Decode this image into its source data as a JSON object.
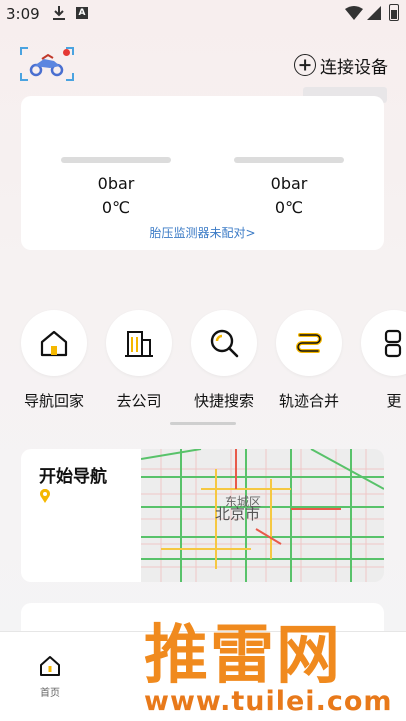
{
  "status_bar": {
    "time": "3:09",
    "a_badge": "A"
  },
  "header": {
    "connect_label": "连接设备"
  },
  "tire_card": {
    "left": {
      "pressure": "0bar",
      "temperature": "0℃"
    },
    "right": {
      "pressure": "0bar",
      "temperature": "0℃"
    },
    "link_text": "胎压监测器未配对>"
  },
  "quick_actions": [
    {
      "label": "导航回家",
      "icon": "home-icon"
    },
    {
      "label": "去公司",
      "icon": "building-icon"
    },
    {
      "label": "快捷搜索",
      "icon": "search-icon"
    },
    {
      "label": "轨迹合并",
      "icon": "track-merge-icon"
    },
    {
      "label": "更",
      "icon": "more-icon"
    }
  ],
  "nav_card": {
    "title": "开始导航",
    "map_city": "北京市",
    "map_district": "东城区"
  },
  "bottom_nav": {
    "home_label": "首页"
  },
  "watermark": {
    "brand": "推雷网",
    "url": "www.tuilei.com"
  },
  "colors": {
    "accent_yellow": "#f5b800",
    "link_blue": "#3b7bc6",
    "watermark_orange": "#f08a1e"
  }
}
